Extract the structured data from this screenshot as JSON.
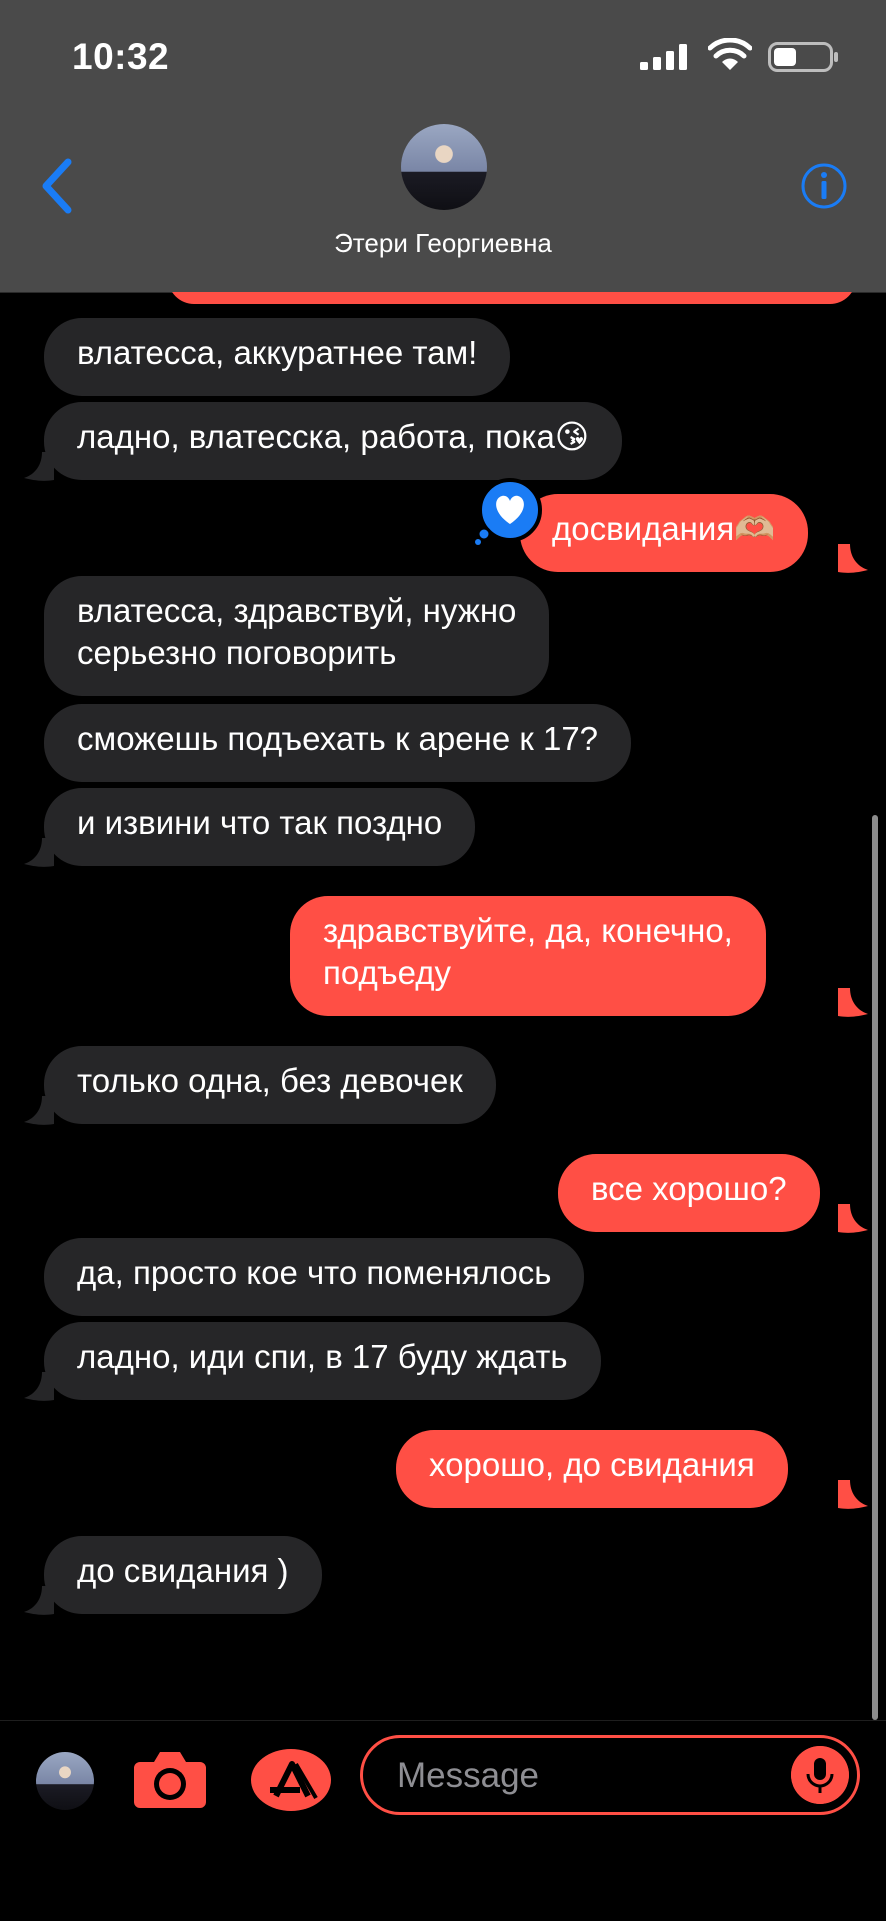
{
  "status": {
    "time": "10:32"
  },
  "contact": {
    "name": "Этери Георгиевна"
  },
  "messages": [
    {
      "dir": "in",
      "text": "влатесса, аккуратнее там!"
    },
    {
      "dir": "in",
      "text": "ладно, влатесска, работа, пока😘"
    },
    {
      "dir": "out",
      "text": "досвидания🫶🏼",
      "reaction": "heart"
    },
    {
      "dir": "in",
      "text": "влатесса, здравствуй, нужно\nсерьезно поговорить"
    },
    {
      "dir": "in",
      "text": "сможешь подъехать к арене к 17?"
    },
    {
      "dir": "in",
      "text": "и извини что так поздно"
    },
    {
      "dir": "out",
      "text": "здравствуйте, да, конечно,\nподъеду"
    },
    {
      "dir": "in",
      "text": "только одна, без девочек"
    },
    {
      "dir": "out",
      "text": "все хорошо?"
    },
    {
      "dir": "in",
      "text": "да, просто кое что поменялось"
    },
    {
      "dir": "in",
      "text": "ладно, иди спи, в 17 буду ждать"
    },
    {
      "dir": "out",
      "text": "хорошо, до свидания"
    },
    {
      "dir": "in",
      "text": "до свидания )"
    }
  ],
  "composer": {
    "placeholder": "Message"
  },
  "colors": {
    "outgoing": "#ff4f45",
    "incoming": "#262628",
    "accent": "#1a7cf5",
    "header": "#4a4a4a"
  },
  "icons": [
    "back-chevron-icon",
    "info-icon",
    "camera-icon",
    "app-store-icon",
    "mic-icon",
    "heart-reaction-icon",
    "signal-icon",
    "wifi-icon",
    "battery-icon"
  ]
}
